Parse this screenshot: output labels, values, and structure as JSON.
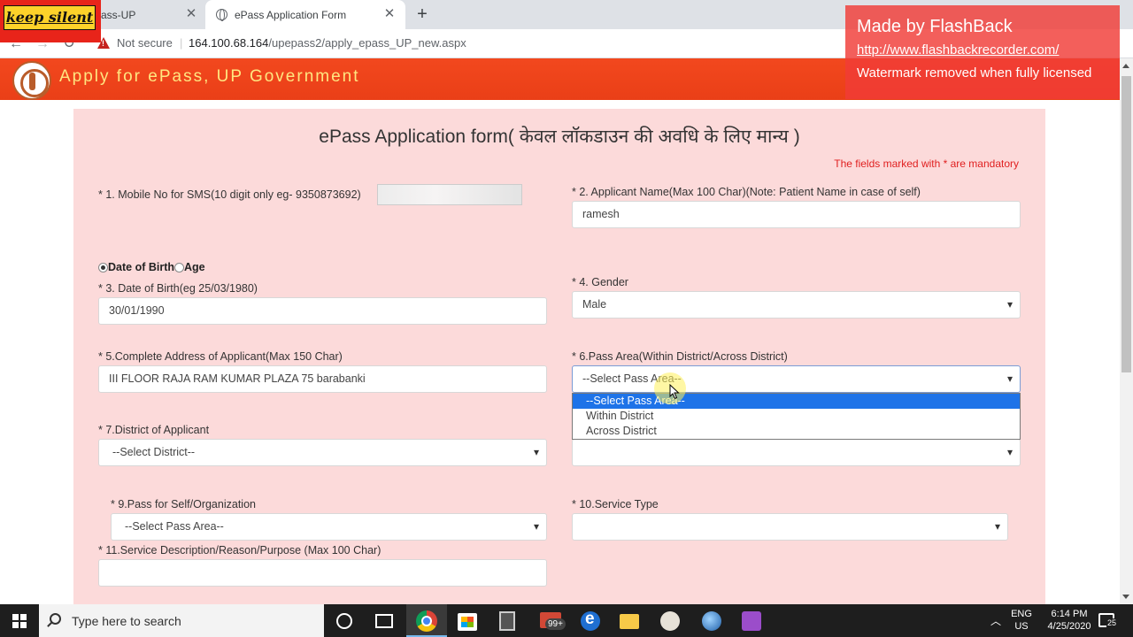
{
  "browser": {
    "tabs": [
      {
        "title": "ass-UP"
      },
      {
        "title": "ePass Application Form"
      }
    ],
    "security_label": "Not secure",
    "url_host": "164.100.68.164",
    "url_path": "/upepass2/apply_epass_UP_new.aspx"
  },
  "watermarks": {
    "keep_silent": "keep silent",
    "flashback_title": "Made by FlashBack",
    "flashback_url": "http://www.flashbackrecorder.com/",
    "flashback_note": "Watermark removed when fully licensed"
  },
  "header": {
    "title": "Apply for ePass, UP Government"
  },
  "form": {
    "heading": "ePass Application form( केवल लॉकडाउन की अवधि के लिए मान्य )",
    "mandatory_note": "The fields marked with * are mandatory",
    "mobile_label": "* 1. Mobile No for SMS(10 digit only eg- 9350873692)",
    "name_label": "* 2. Applicant Name(Max 100 Char)(Note: Patient Name in case of self)",
    "name_value": "ramesh",
    "radio_dob": "Date of Birth",
    "radio_age": "Age",
    "dob_label": "* 3. Date of Birth(eg 25/03/1980)",
    "dob_value": "30/01/1990",
    "gender_label": "* 4. Gender",
    "gender_value": "Male",
    "address_label": "* 5.Complete Address of Applicant(Max 150 Char)",
    "address_value": "III FLOOR RAJA RAM KUMAR PLAZA 75 barabanki",
    "pass_area_label": "* 6.Pass Area(Within District/Across District)",
    "pass_area_value": "--Select Pass Area--",
    "pass_area_options": [
      "--Select Pass Area--",
      "Within District",
      "Across District"
    ],
    "district_label": "* 7.District of Applicant",
    "district_value": "--Select District--",
    "self_org_label": "* 9.Pass for Self/Organization",
    "self_org_value": "--Select Pass Area--",
    "service_type_label": "* 10.Service Type",
    "service_desc_label": "* 11.Service Description/Reason/Purpose (Max 100 Char)"
  },
  "taskbar": {
    "search_placeholder": "Type here to search",
    "mail_badge": "99+",
    "lang_1": "ENG",
    "lang_2": "US",
    "time": "6:14 PM",
    "date": "4/25/2020",
    "notification_count": "25"
  }
}
